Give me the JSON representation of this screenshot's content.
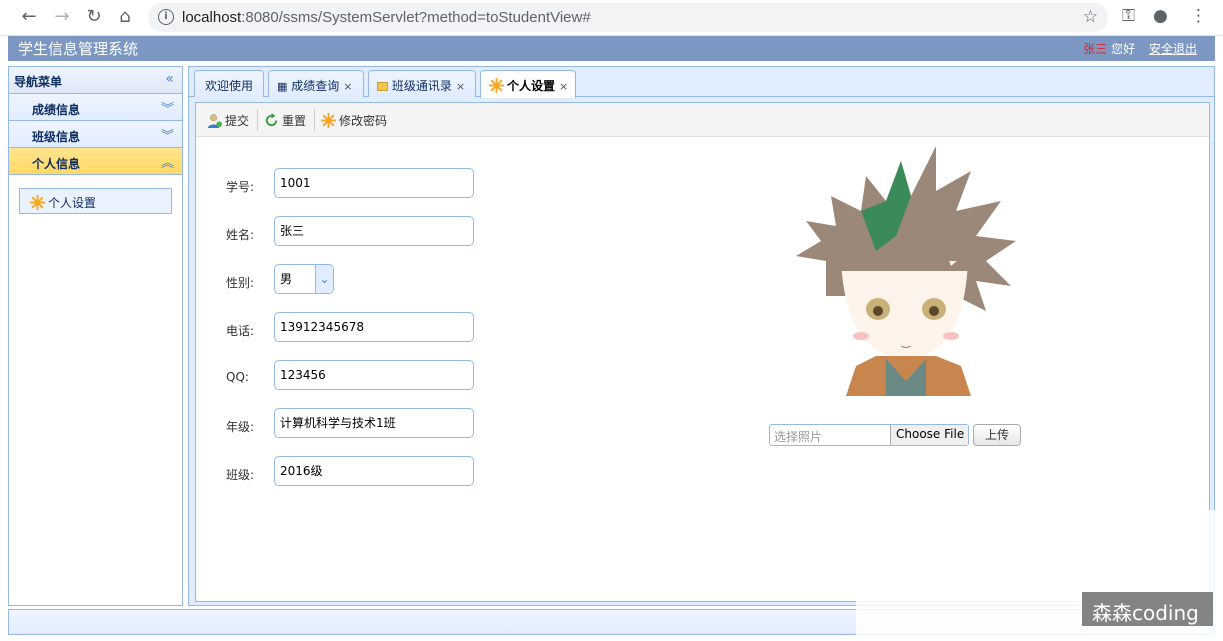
{
  "browser": {
    "url_host": "localhost",
    "url_path": ":8080/ssms/SystemServlet?method=toStudentView#"
  },
  "header": {
    "title": "学生信息管理系统",
    "user_name": "张三",
    "greeting": "您好",
    "logout": "安全退出"
  },
  "sidebar": {
    "title": "导航菜单",
    "items": [
      {
        "label": "成绩信息"
      },
      {
        "label": "班级信息"
      },
      {
        "label": "个人信息"
      }
    ],
    "link": "个人设置"
  },
  "tabs": [
    {
      "label": "欢迎使用"
    },
    {
      "label": "成绩查询"
    },
    {
      "label": "班级通讯录"
    },
    {
      "label": "个人设置"
    }
  ],
  "toolbar": {
    "submit": "提交",
    "reset": "重置",
    "change_password": "修改密码"
  },
  "form": {
    "student_id_label": "学号:",
    "student_id": "1001",
    "name_label": "姓名:",
    "name": "张三",
    "gender_label": "性别:",
    "gender": "男",
    "phone_label": "电话:",
    "phone": "13912345678",
    "qq_label": "QQ:",
    "qq": "123456",
    "grade_label": "年级:",
    "grade": "计算机科学与技术1班",
    "class_label": "班级:",
    "class": "2016级"
  },
  "photo": {
    "placeholder": "选择照片",
    "choose_file": "Choose File",
    "upload": "上传"
  },
  "watermark": "森森coding"
}
